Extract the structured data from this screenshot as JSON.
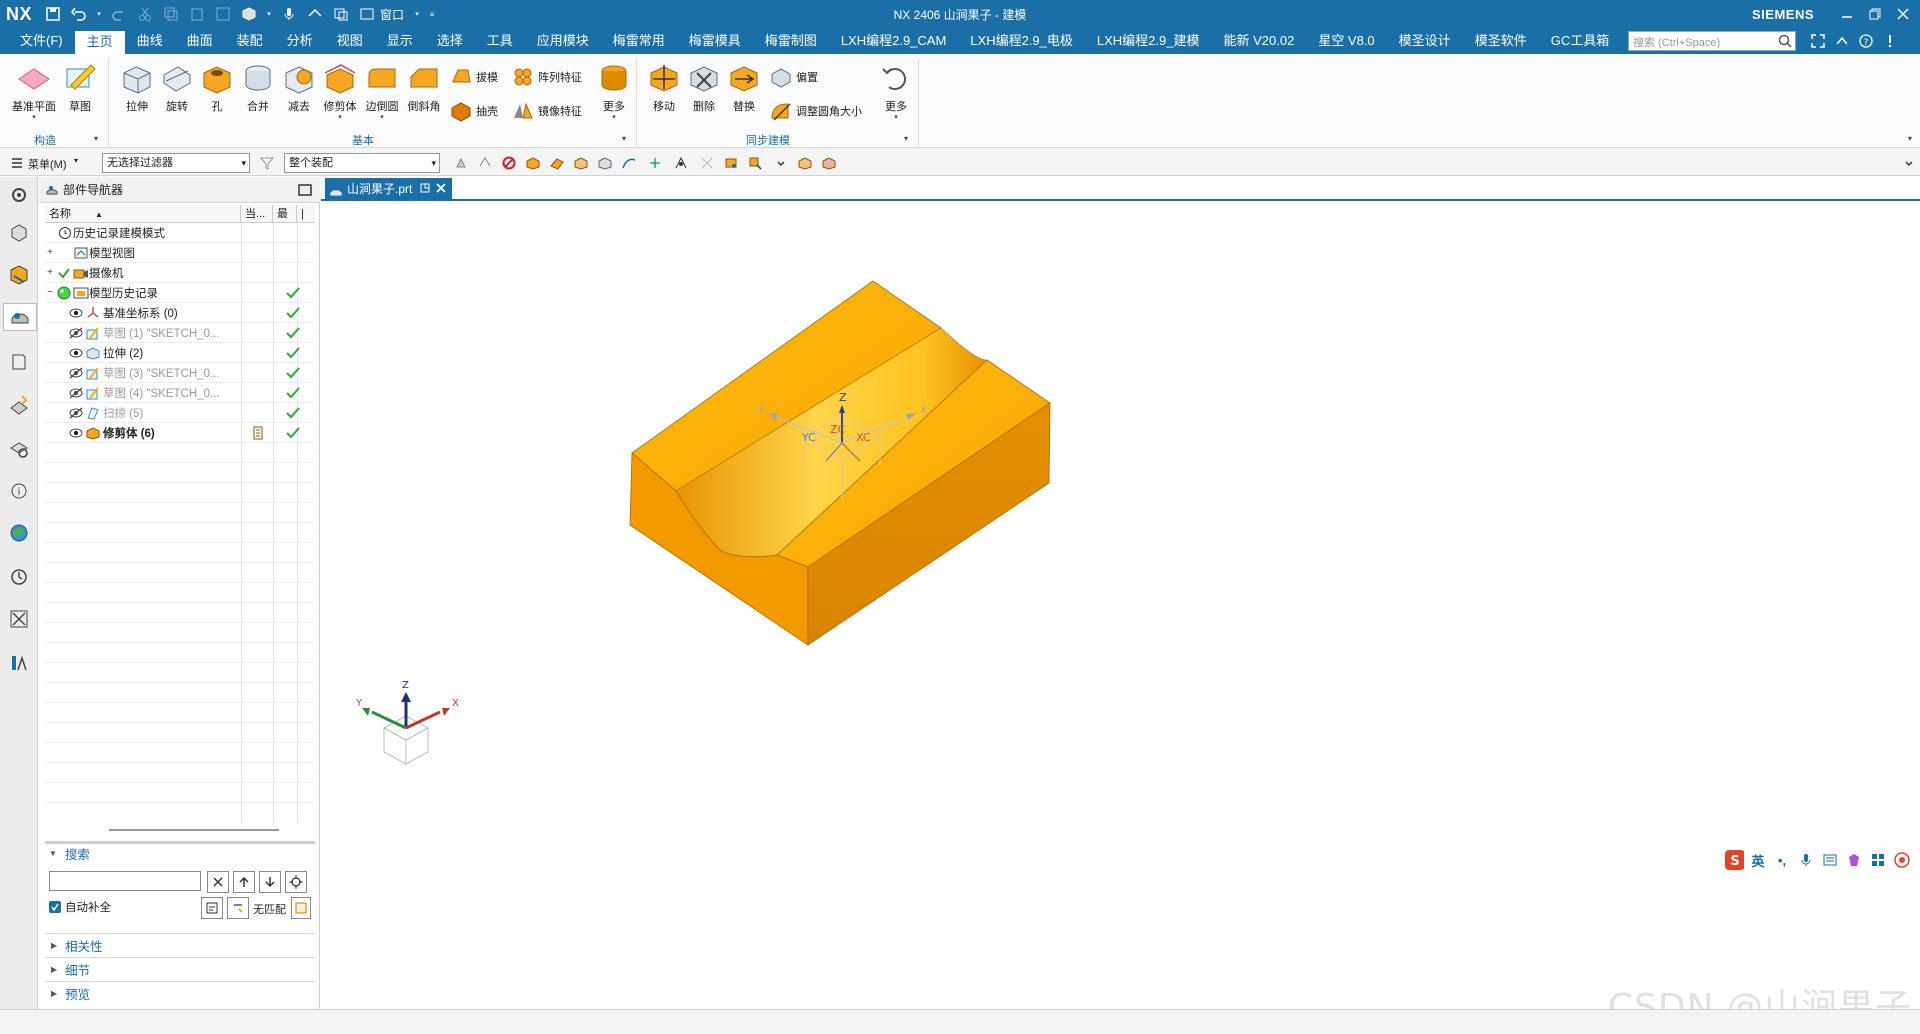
{
  "app": {
    "logo": "NX",
    "title": "NX 2406 山涧果子 - 建模",
    "brand": "SIEMENS",
    "quick_window_label": "窗口"
  },
  "menubar": {
    "items": [
      "文件(F)",
      "主页",
      "曲线",
      "曲面",
      "装配",
      "分析",
      "视图",
      "显示",
      "选择",
      "工具",
      "应用模块",
      "梅雷常用",
      "梅雷模具",
      "梅雷制图",
      "LXH编程2.9_CAM",
      "LXH编程2.9_电极",
      "LXH编程2.9_建模",
      "能新 V20.02",
      "星空 V8.0",
      "模圣设计",
      "模圣软件",
      "GC工具箱"
    ],
    "active_index": 1,
    "search_placeholder": "搜索 (Ctrl+Space)"
  },
  "ribbon": {
    "construct": {
      "label": "构造",
      "buttons": [
        "基准平面",
        "草图"
      ]
    },
    "basic": {
      "label": "基本",
      "buttons": [
        "拉伸",
        "旋转",
        "孔",
        "合并",
        "减去",
        "修剪体",
        "边倒圆",
        "倒斜角"
      ],
      "small": [
        "拔模",
        "阵列特征",
        "抽壳",
        "镜像特征"
      ],
      "more": "更多"
    },
    "sync": {
      "label": "同步建模",
      "buttons": [
        "移动",
        "删除",
        "替换"
      ],
      "small": [
        "偏置",
        "调整圆角大小"
      ],
      "more": "更多"
    }
  },
  "selbar": {
    "menu_label": "菜单(M)",
    "filter": "无选择过滤器",
    "scope": "整个装配"
  },
  "navigator": {
    "title": "部件导航器",
    "columns": [
      "名称",
      "当...",
      "最",
      "|"
    ],
    "rows": [
      {
        "label": "历史记录建模模式",
        "level": 0,
        "expand": "",
        "style": "normal",
        "check": false
      },
      {
        "label": "模型视图",
        "level": 0,
        "expand": "+",
        "style": "normal",
        "check": false
      },
      {
        "label": "摄像机",
        "level": 0,
        "expand": "+",
        "style": "normal",
        "check": false
      },
      {
        "label": "模型历史记录",
        "level": 0,
        "expand": "−",
        "style": "normal",
        "check": true
      },
      {
        "label": "基准坐标系 (0)",
        "level": 1,
        "expand": "",
        "style": "normal",
        "check": true
      },
      {
        "label": "草图 (1) \"SKETCH_0...",
        "level": 1,
        "expand": "",
        "style": "gray",
        "check": true
      },
      {
        "label": "拉伸 (2)",
        "level": 1,
        "expand": "",
        "style": "normal",
        "check": true
      },
      {
        "label": "草图 (3) \"SKETCH_0...",
        "level": 1,
        "expand": "",
        "style": "gray",
        "check": true
      },
      {
        "label": "草图 (4) \"SKETCH_0...",
        "level": 1,
        "expand": "",
        "style": "gray",
        "check": true
      },
      {
        "label": "扫掠 (5)",
        "level": 1,
        "expand": "",
        "style": "gray",
        "check": true
      },
      {
        "label": "修剪体 (6)",
        "level": 1,
        "expand": "",
        "style": "bold",
        "check": true
      }
    ],
    "search": {
      "title": "搜索",
      "autocomplete": "自动补全",
      "nomatch": "无匹配"
    },
    "sections": [
      "相关性",
      "细节",
      "预览"
    ]
  },
  "document": {
    "tab_label": "山涧果子.prt"
  },
  "viewport": {
    "wcs_labels": {
      "z": "Z",
      "y": "Y",
      "x": "X",
      "zc": "ZC",
      "yc": "YC",
      "xc": "XC"
    },
    "triad_labels": {
      "z": "Z",
      "y": "Y",
      "x": "X"
    }
  },
  "ime": {
    "lang": "英"
  },
  "watermark": "CSDN @山涧果子",
  "colors": {
    "accent": "#1a6fa6",
    "part_top": "#ffb300",
    "part_side": "#e89400",
    "part_dark": "#c97c00",
    "check": "#2ea836"
  }
}
